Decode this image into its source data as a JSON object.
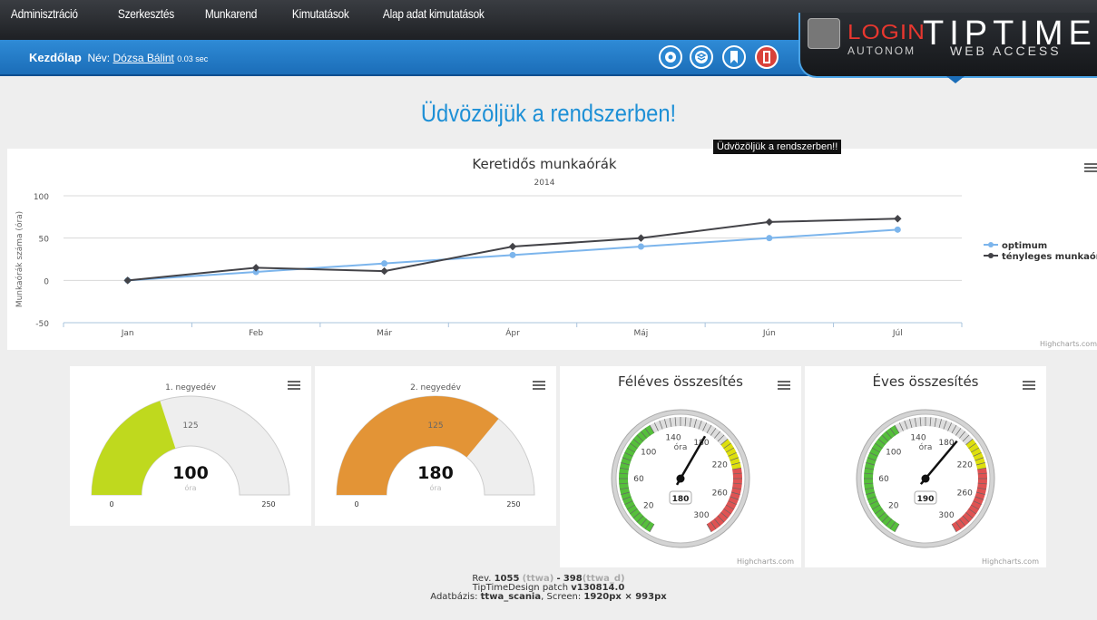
{
  "menu": [
    "Adminisztráció",
    "Szerkesztés",
    "Munkarend",
    "Kimutatások",
    "Alap adat kimutatások"
  ],
  "crumb": {
    "home": "Kezdőlap",
    "name_label": "Név:",
    "user": "Dózsa Bálint",
    "time": "0.03 sec"
  },
  "toolbar_icons": [
    "settings-icon",
    "layers-icon",
    "bookmark-icon",
    "logout-icon"
  ],
  "logo": {
    "login": "LOGIN",
    "autonom": "AUTONOM",
    "tiptime": "TIPTIME",
    "webaccess": "WEB ACCESS"
  },
  "welcome": "Üdvözöljük a rendszerben!",
  "tooltip": "Üdvözöljük a rendszerben!!",
  "credit": "Highcharts.com",
  "chart_data": [
    {
      "type": "line",
      "title": "Keretidős munkaórák",
      "subtitle": "2014",
      "ylabel": "Munkaórák száma (óra)",
      "ylim": [
        -50,
        100
      ],
      "yticks": [
        -50,
        0,
        50,
        100
      ],
      "categories": [
        "Jan",
        "Feb",
        "Már",
        "Ápr",
        "Máj",
        "Jún",
        "Júl"
      ],
      "series": [
        {
          "name": "optimum",
          "color": "#7cb5ec",
          "values": [
            0,
            10,
            20,
            30,
            40,
            50,
            60
          ]
        },
        {
          "name": "tényleges munkaórák",
          "color": "#434348",
          "values": [
            0,
            15,
            11,
            40,
            50,
            69,
            73
          ]
        }
      ],
      "legend": "right"
    },
    {
      "type": "solidgauge",
      "title": "1. negyedév",
      "value": 100,
      "unit": "óra",
      "min": 0,
      "max": 250,
      "mid": 125,
      "color": "#bfd91e"
    },
    {
      "type": "solidgauge",
      "title": "2. negyedév",
      "value": 180,
      "unit": "óra",
      "min": 0,
      "max": 250,
      "mid": 125,
      "color": "#e39436"
    },
    {
      "type": "gauge",
      "title": "Féléves összesítés",
      "value": 180,
      "unit": "óra",
      "min": 0,
      "max": 300,
      "labels": [
        20,
        60,
        100,
        140,
        180,
        220,
        260,
        300
      ]
    },
    {
      "type": "gauge",
      "title": "Éves összesítés",
      "value": 190,
      "unit": "óra",
      "min": 0,
      "max": 300,
      "labels": [
        20,
        60,
        100,
        140,
        180,
        220,
        260,
        300
      ]
    }
  ],
  "footer": {
    "rev_label": "Rev.",
    "rev": "1055",
    "rev_tag": "(ttwa)",
    "dash": "-",
    "rev2": "398",
    "rev2_tag": "(ttwa_d)",
    "patch_label": "TipTimeDesign patch",
    "patch": "v130814.0",
    "db_label": "Adatbázis:",
    "db": "ttwa_scania",
    "screen_label": ", Screen:",
    "screen": "1920px × 993px"
  }
}
